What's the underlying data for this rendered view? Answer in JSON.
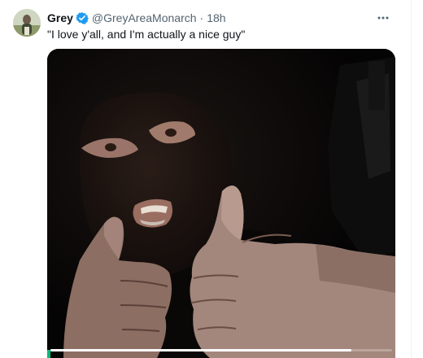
{
  "tweet": {
    "author": {
      "name": "Grey",
      "handle": "@GreyAreaMonarch",
      "verified": true
    },
    "separator": "·",
    "time": "18h",
    "text": "\"I love y'all, and I'm actually a nice guy\"",
    "media": {
      "type": "video",
      "progress": 0.88
    }
  },
  "icons": {
    "avatar": "avatar-photo",
    "verified": "verified-badge-icon",
    "more": "more-options-icon"
  },
  "colors": {
    "verified_blue": "#1d9bf0",
    "secondary_text": "#536471",
    "primary_text": "#0f1419",
    "progress_accent": "#00ba7c"
  }
}
